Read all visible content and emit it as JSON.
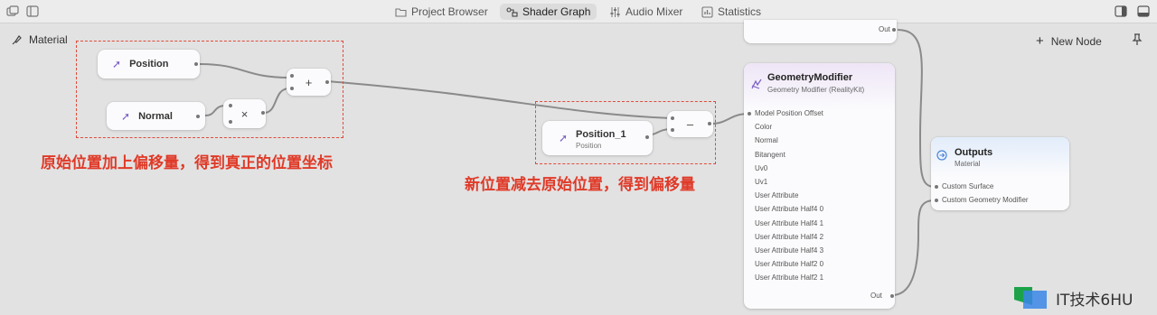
{
  "tabs": [
    {
      "label": "Project Browser",
      "icon": "folder-icon"
    },
    {
      "label": "Shader Graph",
      "icon": "shader-graph-icon",
      "active": true
    },
    {
      "label": "Audio Mixer",
      "icon": "audio-mixer-icon"
    },
    {
      "label": "Statistics",
      "icon": "statistics-icon"
    }
  ],
  "breadcrumb": {
    "material": "Material"
  },
  "toolbar": {
    "new_node": "New Node"
  },
  "nodes": {
    "position": {
      "label": "Position"
    },
    "normal": {
      "label": "Normal"
    },
    "multiply": {
      "symbol": "×"
    },
    "add": {
      "symbol": "+"
    },
    "position_1": {
      "label": "Position_1",
      "subtitle": "Position"
    },
    "subtract": {
      "symbol": "–"
    },
    "top_node": {
      "out": "Out"
    },
    "geometry_modifier": {
      "title": "GeometryModifier",
      "subtitle": "Geometry Modifier (RealityKit)",
      "inputs": [
        "Model Position Offset",
        "Color",
        "Normal",
        "Bitangent",
        "Uv0",
        "Uv1",
        "User Attribute",
        "User Attribute Half4 0",
        "User Attribute Half4 1",
        "User Attribute Half4 2",
        "User Attribute Half4 3",
        "User Attribute Half2 0",
        "User Attribute Half2 1"
      ],
      "out": "Out"
    },
    "outputs": {
      "title": "Outputs",
      "subtitle": "Material",
      "inputs": [
        "Custom Surface",
        "Custom Geometry Modifier"
      ]
    }
  },
  "annotations": {
    "left": "原始位置加上偏移量，得到真正的位置坐标",
    "right": "新位置减去原始位置，得到偏移量"
  },
  "watermark": {
    "text": "IT技术6HU"
  },
  "colors": {
    "accent_purple": "#7a5cc7",
    "annotation_red": "#e03a28",
    "outputs_blue": "#4a86d8"
  }
}
